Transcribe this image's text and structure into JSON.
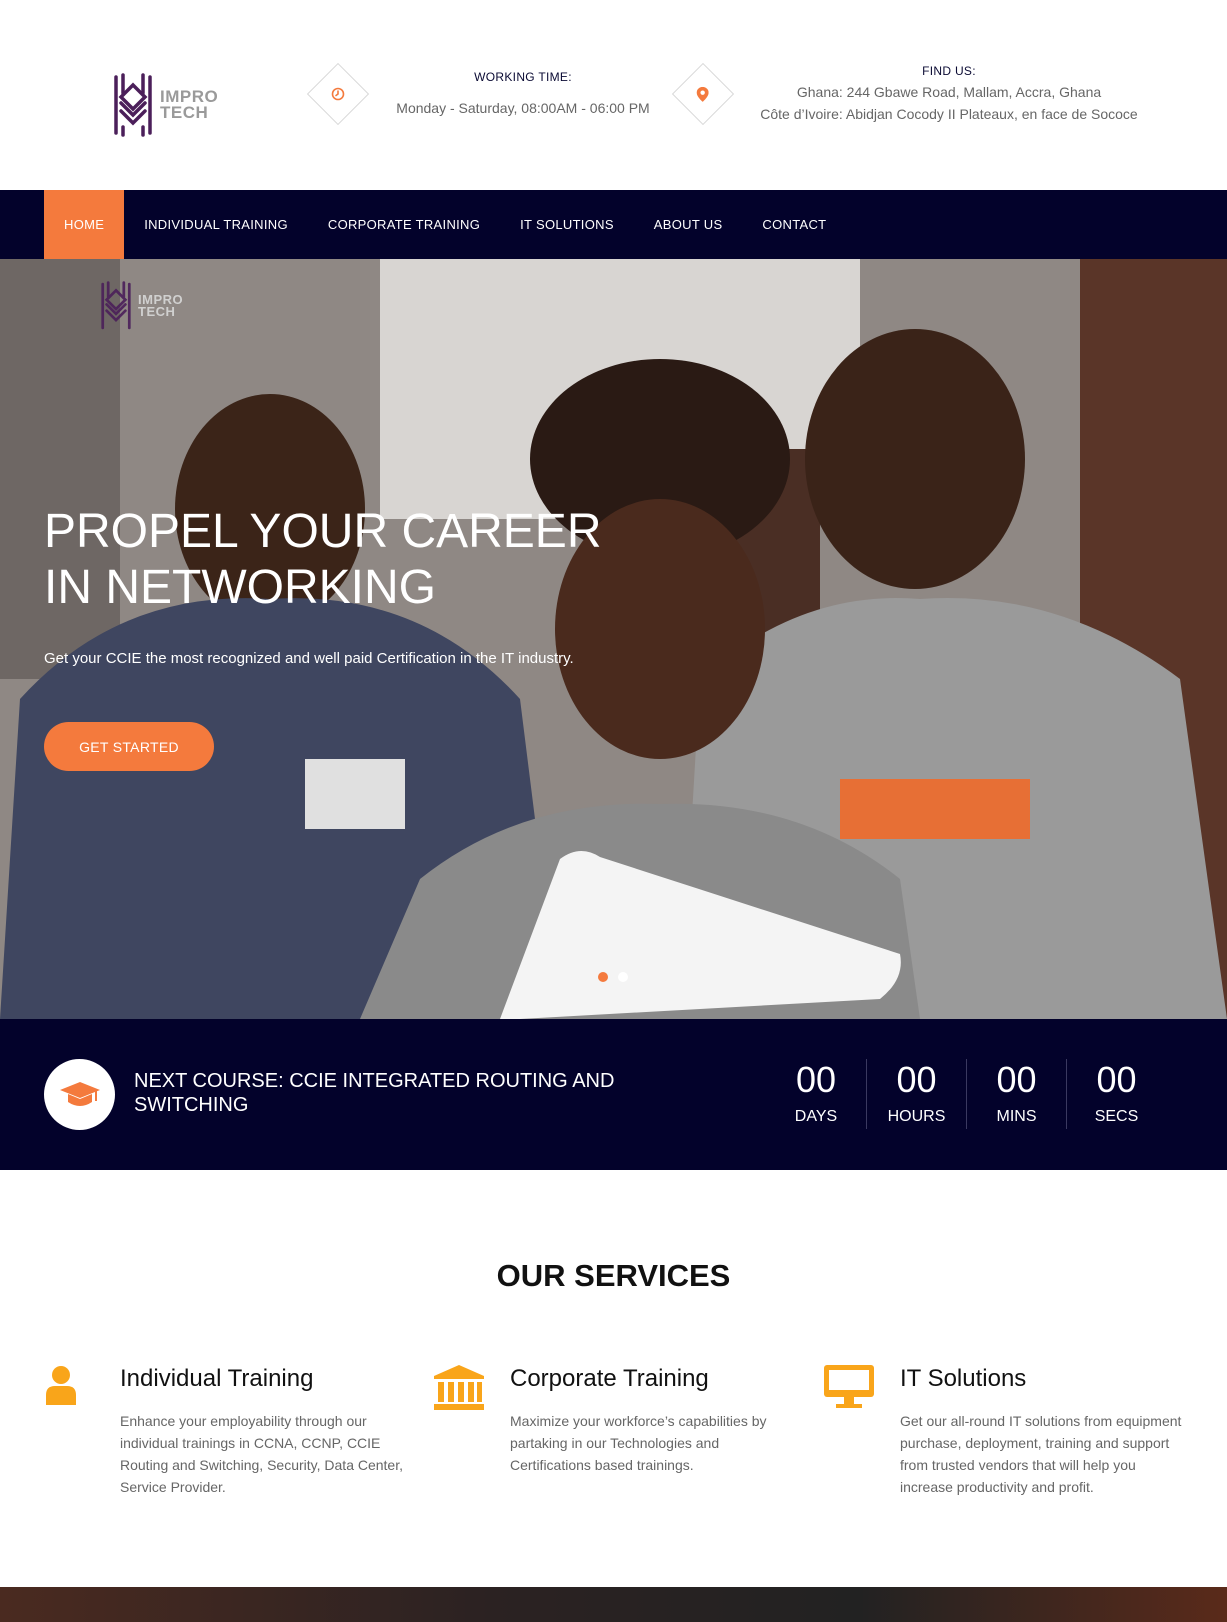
{
  "brand": {
    "line1": "IMPRO",
    "line2": "TECH"
  },
  "header": {
    "working_label": "WORKING TIME:",
    "working_value": "Monday - Saturday, 08:00AM - 06:00 PM",
    "find_label": "FIND US:",
    "find_line1": "Ghana: 244 Gbawe Road, Mallam, Accra, Ghana",
    "find_line2": "Côte d’Ivoire: Abidjan Cocody II Plateaux, en face de Sococe"
  },
  "nav": {
    "items": [
      {
        "label": "HOME"
      },
      {
        "label": "INDIVIDUAL TRAINING"
      },
      {
        "label": "CORPORATE TRAINING"
      },
      {
        "label": "IT SOLUTIONS"
      },
      {
        "label": "ABOUT US"
      },
      {
        "label": "CONTACT"
      }
    ]
  },
  "hero": {
    "title_line1": "PROPEL YOUR CAREER",
    "title_line2": "IN NETWORKING",
    "subtitle": "Get your CCIE the most recognized and well paid Certification in the IT industry.",
    "button": "GET STARTED",
    "slide_count": 2,
    "active_slide": 1
  },
  "countdown": {
    "next_course": "NEXT COURSE: CCIE INTEGRATED ROUTING AND SWITCHING",
    "cells": [
      {
        "value": "00",
        "label": "DAYS"
      },
      {
        "value": "00",
        "label": "HOURS"
      },
      {
        "value": "00",
        "label": "MINS"
      },
      {
        "value": "00",
        "label": "SECS"
      }
    ]
  },
  "services": {
    "title": "OUR SERVICES",
    "items": [
      {
        "icon": "user-icon",
        "title": "Individual Training",
        "text": "Enhance your employability through our individual trainings in CCNA, CCNP, CCIE Routing and Switching, Security, Data Center, Service Provider."
      },
      {
        "icon": "institution-icon",
        "title": "Corporate Training",
        "text": "Maximize your workforce’s capabilities by partaking in our Technologies and Certifications based trainings."
      },
      {
        "icon": "monitor-icon",
        "title": "IT Solutions",
        "text": "Get our all-round IT solutions from equipment purchase, deployment, training and support from trusted vendors that will help you increase productivity and profit."
      }
    ]
  },
  "colors": {
    "accent": "#f47a3d",
    "navy": "#03022b",
    "service_icon": "#f9a51a",
    "logo_purple": "#4b1f5a"
  }
}
